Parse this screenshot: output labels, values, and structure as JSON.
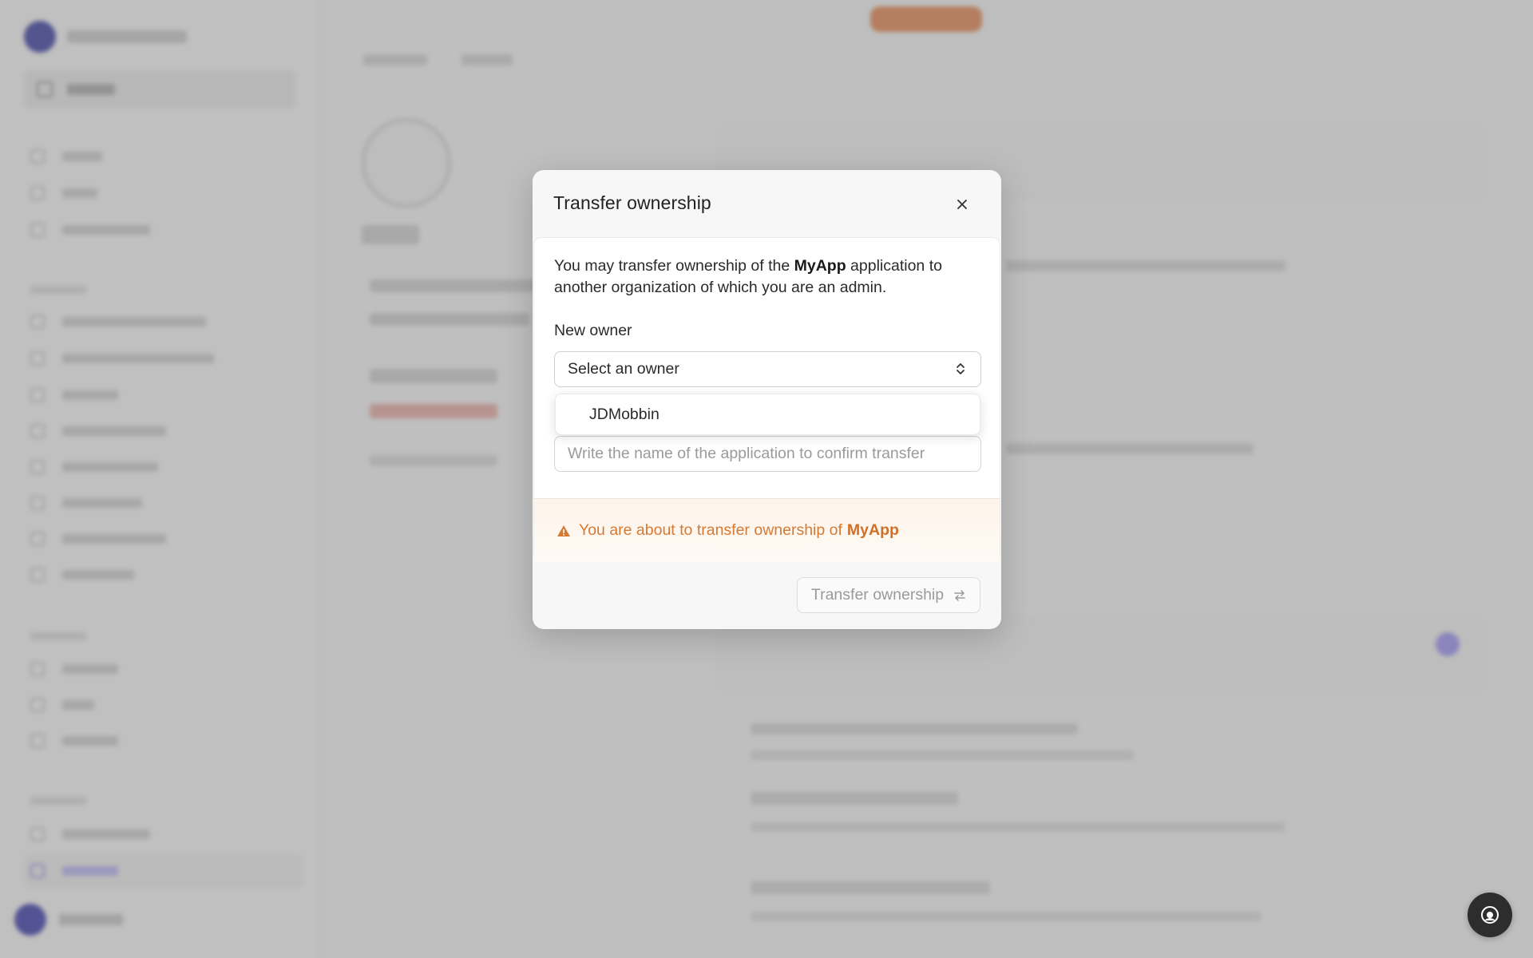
{
  "modal": {
    "title": "Transfer ownership",
    "description_prefix": "You may transfer ownership of the",
    "app_name": "MyApp",
    "description_suffix": "application to another organization of which you are an admin.",
    "new_owner_label": "New owner",
    "select_value": "Select an owner",
    "dropdown_options": [
      "JDMobbin"
    ],
    "confirm_placeholder": "Write the name of the application to confirm transfer",
    "warning_prefix": "You are about to transfer ownership of",
    "warning_app": "MyApp",
    "transfer_button_label": "Transfer ownership"
  },
  "icons": {
    "close": "close-icon",
    "select_chevron": "chevron-up-down-icon",
    "warning": "warning-triangle-icon",
    "transfer": "arrows-swap-icon",
    "help": "support-agent-icon"
  },
  "colors": {
    "warning_text": "#d57a34",
    "overlay": "rgba(120,120,120,0.42)",
    "accent_purple": "#8c84e6",
    "top_pill": "#e0824c"
  }
}
